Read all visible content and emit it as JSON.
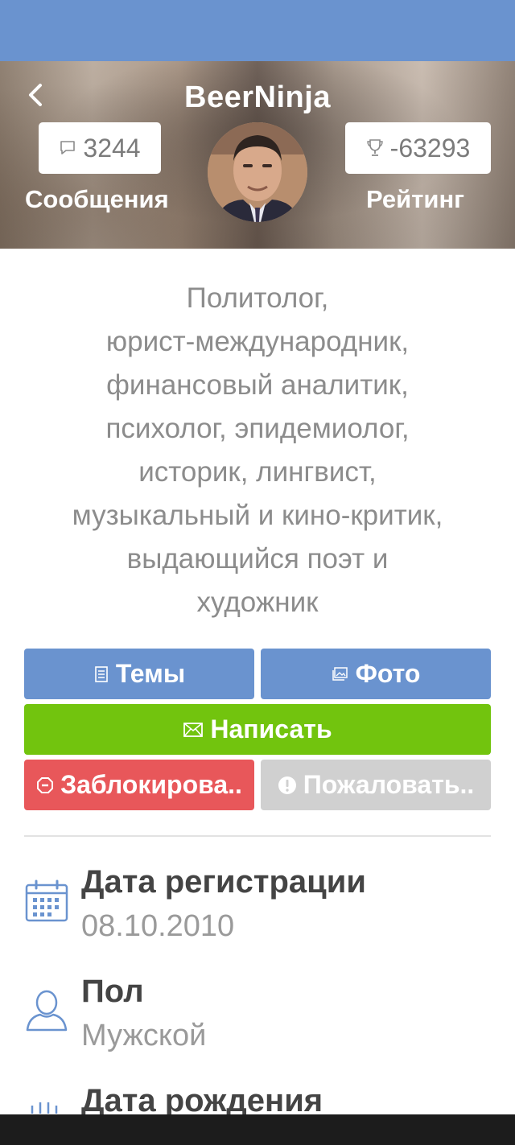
{
  "profile": {
    "username": "BeerNinja",
    "messages_count": "3244",
    "messages_label": "Сообщения",
    "rating_value": "-63293",
    "rating_label": "Рейтинг"
  },
  "bio_lines": [
    "Политолог,",
    "юрист-международник,",
    "финансовый аналитик,",
    "психолог, эпидемиолог,",
    "историк, лингвист,",
    "музыкальный и кино-критик,",
    "выдающийся поэт и",
    "художник"
  ],
  "actions": {
    "topics": "Темы",
    "photo": "Фото",
    "write": "Написать",
    "block": "Заблокирова..",
    "report": "Пожаловать.."
  },
  "info": {
    "registration_title": "Дата регистрации",
    "registration_value": "08.10.2010",
    "gender_title": "Пол",
    "gender_value": "Мужской",
    "birthdate_title": "Дата рождения"
  },
  "colors": {
    "header_blue": "#6a93cf",
    "write_green": "#72c40e",
    "block_red": "#e8575a",
    "report_gray": "#d0d0d0"
  },
  "icons": {
    "back": "chevron-left-icon",
    "messages": "speech-bubble-icon",
    "rating": "trophy-icon",
    "topics": "document-icon",
    "photo": "photo-icon",
    "write": "envelope-icon",
    "block": "block-icon",
    "report": "exclamation-icon",
    "registration": "calendar-icon",
    "gender": "user-icon"
  }
}
